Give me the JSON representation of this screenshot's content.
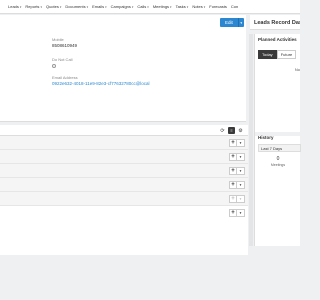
{
  "nav": {
    "items": [
      "Leads",
      "Reports",
      "Quotes",
      "Documents",
      "Emails",
      "Campaigns",
      "Calls",
      "Meetings",
      "Tasks",
      "Notes",
      "Forecasts",
      "Con"
    ]
  },
  "record": {
    "edit_label": "Edit",
    "mobile_label": "Mobile",
    "mobile_value": "8508610949",
    "do_not_call_label": "Do Not Call",
    "email_label": "Email Address",
    "email_value": "0922e632-4018-11e9-82e3-cf77632780cc@local"
  },
  "dashlet": {
    "header_title": "Leads Record Dash",
    "planned_title": "Planned Activities",
    "tab_today": "Today",
    "tab_future": "Future",
    "no_data": "No",
    "history_title": "History",
    "history_filter": "Last 7 Days",
    "history_count": "0",
    "history_count_label": "Meetings"
  },
  "colors": {
    "accent": "#2a87d0",
    "dark": "#3a3a3a"
  }
}
